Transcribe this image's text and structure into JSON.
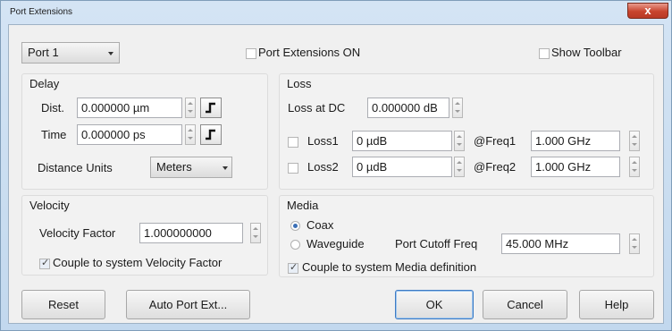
{
  "window": {
    "title": "Port Extensions",
    "close_glyph": "x"
  },
  "top": {
    "port_select": "Port 1",
    "port_ext_on": {
      "label": "Port Extensions ON",
      "checked": false
    },
    "show_toolbar": {
      "label": "Show Toolbar",
      "checked": false
    }
  },
  "delay": {
    "title": "Delay",
    "dist_label": "Dist.",
    "dist_value": "0.000000 µm",
    "time_label": "Time",
    "time_value": "0.000000 ps",
    "units_label": "Distance Units",
    "units_value": "Meters"
  },
  "loss": {
    "title": "Loss",
    "dc_label": "Loss at DC",
    "dc_value": "0.000000 dB",
    "loss1": {
      "label": "Loss1",
      "value": "0 µdB",
      "freq_label": "@Freq1",
      "freq_value": "1.000 GHz",
      "checked": false
    },
    "loss2": {
      "label": "Loss2",
      "value": "0 µdB",
      "freq_label": "@Freq2",
      "freq_value": "1.000 GHz",
      "checked": false
    }
  },
  "velocity": {
    "title": "Velocity",
    "factor_label": "Velocity Factor",
    "factor_value": "1.000000000",
    "couple_label": "Couple to system Velocity Factor",
    "couple_checked": true
  },
  "media": {
    "title": "Media",
    "coax_label": "Coax",
    "waveguide_label": "Waveguide",
    "selected": "Coax",
    "cutoff_label": "Port Cutoff Freq",
    "cutoff_value": "45.000 MHz",
    "couple_label": "Couple to system Media definition",
    "couple_checked": true
  },
  "buttons": {
    "reset": "Reset",
    "auto_port_ext": "Auto Port Ext...",
    "ok": "OK",
    "cancel": "Cancel",
    "help": "Help"
  },
  "icons": {
    "close": "close-icon",
    "spin": "spin-arrows-icon",
    "step": "step-function-icon",
    "dropdown": "chevron-down-icon"
  }
}
